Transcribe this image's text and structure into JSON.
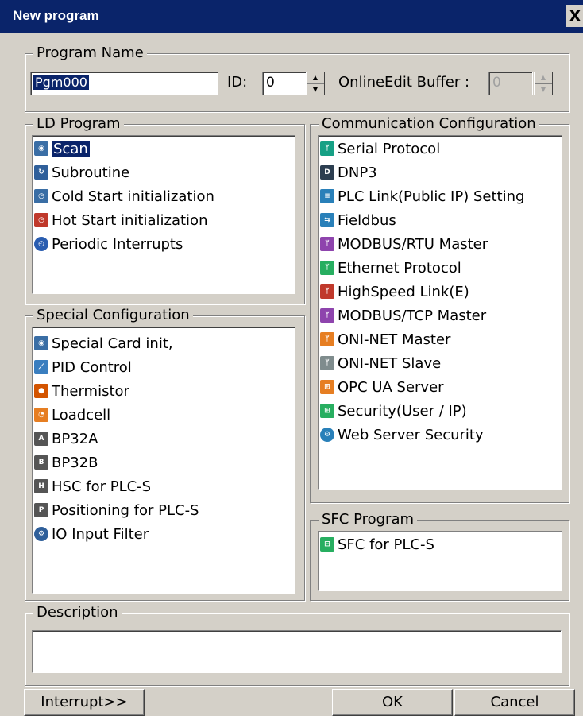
{
  "window": {
    "title": "New program",
    "close_glyph": "X"
  },
  "program_name": {
    "legend": "Program Name",
    "name_value": "Pgm000",
    "id_label": "ID:",
    "id_value": "0",
    "buffer_label": "OnlineEdit Buffer :",
    "buffer_value": "0"
  },
  "ld_program": {
    "legend": "LD Program",
    "items": [
      {
        "label": "Scan",
        "icon": "scan-icon",
        "selected": true
      },
      {
        "label": "Subroutine",
        "icon": "subroutine-icon"
      },
      {
        "label": "Cold Start initialization",
        "icon": "cold-start-icon"
      },
      {
        "label": "Hot Start initialization",
        "icon": "hot-start-icon"
      },
      {
        "label": "Periodic Interrupts",
        "icon": "clock-icon"
      }
    ]
  },
  "special_config": {
    "legend": "Special Configuration",
    "items": [
      {
        "label": "Special Card init,",
        "icon": "special-card-icon"
      },
      {
        "label": "PID Control",
        "icon": "pid-control-icon"
      },
      {
        "label": "Thermistor",
        "icon": "thermistor-icon"
      },
      {
        "label": "Loadcell",
        "icon": "loadcell-icon"
      },
      {
        "label": "BP32A",
        "icon": "bp32a-icon"
      },
      {
        "label": "BP32B",
        "icon": "bp32b-icon"
      },
      {
        "label": "HSC for PLC-S",
        "icon": "hsc-icon"
      },
      {
        "label": "Positioning for PLC-S",
        "icon": "positioning-icon"
      },
      {
        "label": "IO Input Filter",
        "icon": "io-filter-icon"
      }
    ]
  },
  "comm_config": {
    "legend": "Communication Configuration",
    "items": [
      {
        "label": "Serial Protocol",
        "icon": "serial-protocol-icon"
      },
      {
        "label": "DNP3",
        "icon": "dnp3-icon"
      },
      {
        "label": "PLC Link(Public IP) Setting",
        "icon": "plc-link-icon"
      },
      {
        "label": "Fieldbus",
        "icon": "fieldbus-icon"
      },
      {
        "label": "MODBUS/RTU Master",
        "icon": "modbus-rtu-icon"
      },
      {
        "label": "Ethernet Protocol",
        "icon": "ethernet-icon"
      },
      {
        "label": "HighSpeed Link(E)",
        "icon": "highspeed-link-icon"
      },
      {
        "label": "MODBUS/TCP Master",
        "icon": "modbus-tcp-icon"
      },
      {
        "label": "ONI-NET Master",
        "icon": "oni-net-master-icon"
      },
      {
        "label": "ONI-NET Slave",
        "icon": "oni-net-slave-icon"
      },
      {
        "label": "OPC UA Server",
        "icon": "opc-ua-icon"
      },
      {
        "label": "Security(User / IP)",
        "icon": "security-icon"
      },
      {
        "label": "Web Server Security",
        "icon": "web-security-icon"
      }
    ]
  },
  "sfc_program": {
    "legend": "SFC Program",
    "items": [
      {
        "label": "SFC for PLC-S",
        "icon": "sfc-icon"
      }
    ]
  },
  "description": {
    "legend": "Description",
    "value": ""
  },
  "buttons": {
    "interrupt": "Interrupt>>",
    "ok": "OK",
    "cancel": "Cancel"
  },
  "icon_colors": {
    "scan": "#3a6ea5",
    "subroutine": "#2f5f9a",
    "cold": "#3a6ea5",
    "hot": "#c0392b",
    "clock": "#2a5db0",
    "special": "#3a6ea5",
    "pid": "#3a7ebf",
    "thermistor": "#d35400",
    "loadcell": "#e67e22",
    "bp": "#555555",
    "serial": "#16a085",
    "dnp3": "#2c3e50",
    "plclink": "#2980b9",
    "fieldbus": "#2980b9",
    "modbus": "#8e44ad",
    "ethernet": "#27ae60",
    "highspeed": "#c0392b",
    "oni": "#e67e22",
    "onislave": "#7f8c8d",
    "opc": "#e67e22",
    "security": "#27ae60",
    "web": "#2980b9",
    "sfc": "#27ae60"
  }
}
